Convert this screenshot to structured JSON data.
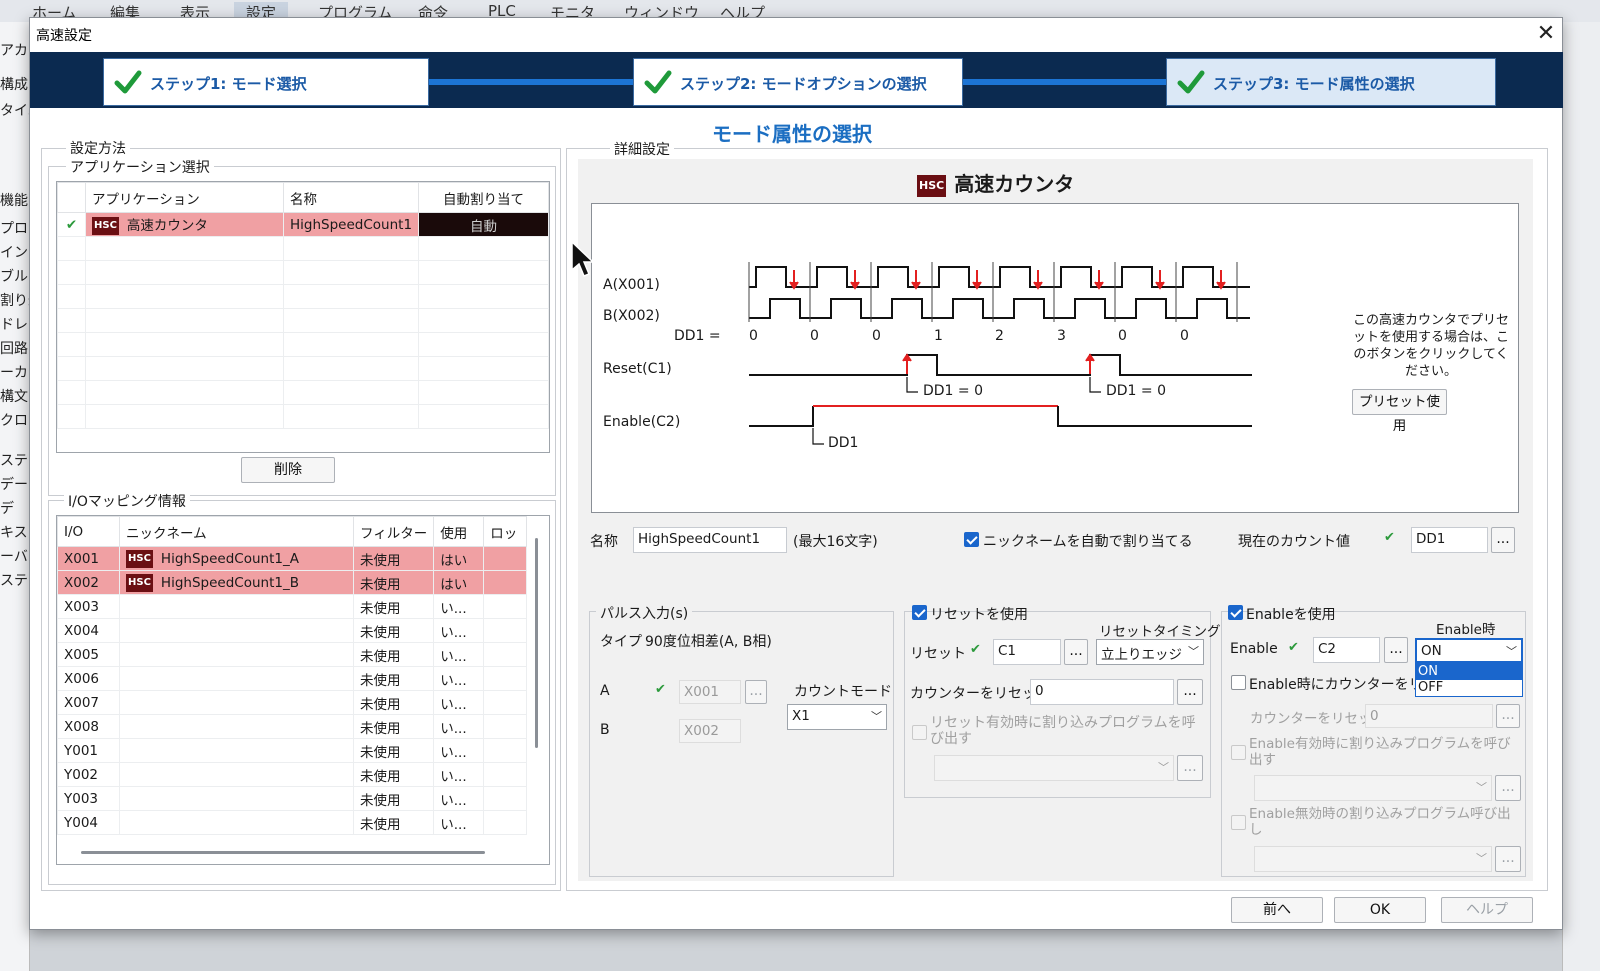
{
  "colors": {
    "accent": "#1b6ec2",
    "step_bar": "#0b2a50",
    "highlight_row": "#f0a0a3",
    "hsc_badge": "#6b0f13",
    "signal_red": "#e32020"
  },
  "background_app": {
    "menu": [
      "ホーム",
      "編集",
      "表示",
      "設定",
      "プログラム",
      "命令",
      "PLC",
      "モニタ",
      "ウィンドウ",
      "ヘルプ"
    ],
    "left_items": [
      "アカ",
      "構成",
      "タイム",
      "機能",
      "プロ",
      "イン",
      "ブル",
      "割り込",
      "ドレ",
      "回路",
      "ーカ",
      "構文",
      "クロス",
      "ステー",
      "データ",
      "デ",
      "キス",
      "ーバ",
      "ステ"
    ]
  },
  "dialog": {
    "title": "高速設定",
    "close_icon": "close-icon",
    "steps": [
      "ステップ1: モード選択",
      "ステップ2: モードオプションの選択",
      "ステップ3: モード属性の選択"
    ],
    "subtitle": "モード属性の選択",
    "left": {
      "settings_method_label": "設定方法",
      "app_select_label": "アプリケーション選択",
      "app_table": {
        "headers": [
          "アプリケーション",
          "名称",
          "自動割り当て"
        ],
        "rows": [
          {
            "app": "高速カウンタ",
            "name": "HighSpeedCount1",
            "auto": "自動"
          }
        ]
      },
      "hsc_badge_text": "HSC",
      "delete_button": "削除",
      "io_mapping_label": "I/Oマッピング情報",
      "io_table": {
        "headers": [
          "I/O",
          "ニックネーム",
          "フィルター",
          "使用",
          "ロッ"
        ],
        "rows": [
          {
            "io": "X001",
            "nick": "HighSpeedCount1_A",
            "filter": "未使用",
            "use": "はい"
          },
          {
            "io": "X002",
            "nick": "HighSpeedCount1_B",
            "filter": "未使用",
            "use": "はい"
          },
          {
            "io": "X003",
            "nick": "",
            "filter": "未使用",
            "use": "い..."
          },
          {
            "io": "X004",
            "nick": "",
            "filter": "未使用",
            "use": "い..."
          },
          {
            "io": "X005",
            "nick": "",
            "filter": "未使用",
            "use": "い..."
          },
          {
            "io": "X006",
            "nick": "",
            "filter": "未使用",
            "use": "い..."
          },
          {
            "io": "X007",
            "nick": "",
            "filter": "未使用",
            "use": "い..."
          },
          {
            "io": "X008",
            "nick": "",
            "filter": "未使用",
            "use": "い..."
          },
          {
            "io": "Y001",
            "nick": "",
            "filter": "未使用",
            "use": "い..."
          },
          {
            "io": "Y002",
            "nick": "",
            "filter": "未使用",
            "use": "い..."
          },
          {
            "io": "Y003",
            "nick": "",
            "filter": "未使用",
            "use": "い..."
          },
          {
            "io": "Y004",
            "nick": "",
            "filter": "未使用",
            "use": "い..."
          }
        ]
      }
    },
    "right": {
      "detail_label": "詳細設定",
      "header_badge": "HSC",
      "header_title": "高速カウンタ",
      "diagram": {
        "signal_a": "A(X001)",
        "signal_b": "B(X002)",
        "dd1_label": "DD1 =",
        "dd1_values": [
          "0",
          "0",
          "0",
          "1",
          "2",
          "3",
          "0",
          "0"
        ],
        "reset_label": "Reset(C1)",
        "enable_label": "Enable(C2)",
        "reset_note": "DD1 = 0",
        "enable_note": "DD1"
      },
      "preset_note": "この高速カウンタでプリセットを使用する場合は、このボタンをクリックしてください。",
      "preset_button": "プリセット使用",
      "name_label": "名称",
      "name_value": "HighSpeedCount1",
      "name_max": "(最大16文字)",
      "auto_nick_label": "ニックネームを自動で割り当てる",
      "current_count_label": "現在のカウント値",
      "current_count_value": "DD1",
      "ellipsis": "...",
      "pulse": {
        "group_label": "パルス入力(s)",
        "type_label": "タイプ",
        "type_value": "90度位相差(A, B相)",
        "a_label": "A",
        "a_value": "X001",
        "b_label": "B",
        "b_value": "X002",
        "count_mode_label": "カウントモード",
        "count_mode_value": "X1"
      },
      "reset": {
        "use_label": "リセットを使用",
        "timing_label": "リセットタイミング",
        "reset_label": "リセット",
        "reset_value": "C1",
        "timing_value": "立上りエッジ",
        "counter_reset_label": "カウンターをリセット",
        "counter_reset_value": "0",
        "interrupt_label": "リセット有効時に割り込みプログラムを呼び出す"
      },
      "enable": {
        "use_label": "Enableを使用",
        "when_label": "Enable時",
        "enable_label": "Enable",
        "enable_value": "C2",
        "when_value": "ON",
        "options": [
          "ON",
          "OFF"
        ],
        "reset_on_enable_label": "Enable時にカウンターをリセ",
        "counter_reset_label": "カウンターをリセット",
        "counter_reset_value": "0",
        "interrupt_enable_label": "Enable有効時に割り込みプログラムを呼び出す",
        "interrupt_disable_label": "Enable無効時の割り込みプログラム呼び出し"
      }
    },
    "footer": {
      "prev": "前へ",
      "ok": "OK",
      "help": "ヘルプ"
    }
  }
}
